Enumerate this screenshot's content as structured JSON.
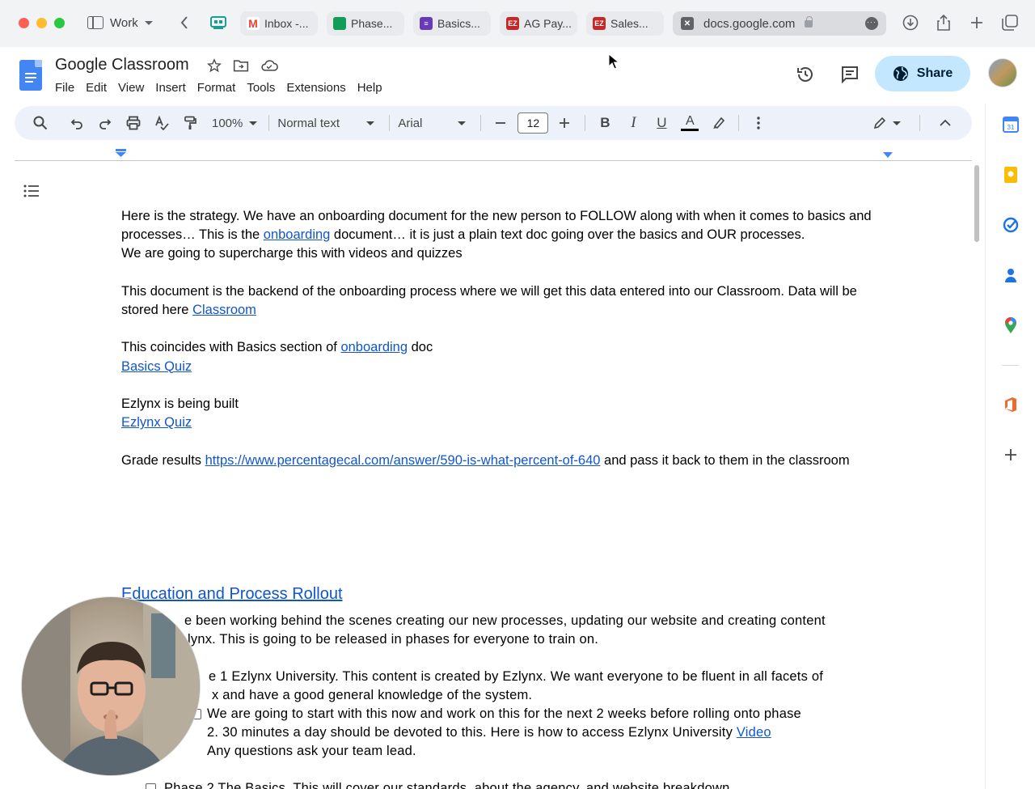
{
  "browser": {
    "profile_label": "Work",
    "tabs": [
      {
        "label": "Inbox -...",
        "favicon": "gmail-icon",
        "color": "#ea4335"
      },
      {
        "label": "Phase...",
        "favicon": "slides-icon",
        "color": "#0f9d58"
      },
      {
        "label": "Basics...",
        "favicon": "forms-icon",
        "color": "#673ab7"
      },
      {
        "label": "AG Pay...",
        "favicon": "ezlynx-icon",
        "color": "#c62828"
      },
      {
        "label": "Sales...",
        "favicon": "ezlynx-icon",
        "color": "#c62828"
      }
    ],
    "active_tab": {
      "label": "docs.google.com"
    }
  },
  "docs": {
    "title": "Google Classroom",
    "menu": [
      "File",
      "Edit",
      "View",
      "Insert",
      "Format",
      "Tools",
      "Extensions",
      "Help"
    ],
    "share_label": "Share"
  },
  "toolbar": {
    "zoom": "100%",
    "style": "Normal text",
    "font": "Arial",
    "font_size": "12"
  },
  "document": {
    "para1_a": "Here is the strategy. We have an onboarding document for the new person to FOLLOW along with when it comes to basics and processes… This is the ",
    "para1_link": "onboarding",
    "para1_b": " document… it is just a plain text doc going over the basics and OUR processes.",
    "para2": "We are going to supercharge this with videos and quizzes",
    "para3_a": "This document is the backend of the onboarding process where we will get this data entered into our Classroom. Data will be stored here ",
    "para3_link": "Classroom",
    "para4_a": "This coincides with Basics section of ",
    "para4_link": "onboarding",
    "para4_b": " doc",
    "basics_quiz": "Basics Quiz",
    "para5": "Ezlynx is being built",
    "ezlynx_quiz": "Ezlynx Quiz",
    "para6_a": "Grade results ",
    "para6_link": "https://www.percentagecal.com/answer/590-is-what-percent-of-640",
    "para6_b": " and pass it back to them in the classroom",
    "heading": "Education and Process Rollout",
    "sec_p1": "e been working behind the scenes creating our new processes, updating our website and creating content",
    "sec_p1b": "lynx. This is going to be released in phases for everyone to train on.",
    "phase1_a": "e 1 Ezlynx University. This content is created by Ezlynx. We want everyone to be fluent in all facets of",
    "phase1_b": "x and have a good general knowledge of the system.",
    "task1_a": "We are going to start with this now and work on this for the next 2 weeks before rolling onto phase",
    "task1_b": "2. 30 minutes a day should be devoted to this. Here is how to access Ezlynx University ",
    "task1_link": "Video",
    "task1_c": "Any questions ask your team lead.",
    "phase2": "Phase 2 The Basics. This will cover our standards, about the agency, and website breakdown"
  }
}
